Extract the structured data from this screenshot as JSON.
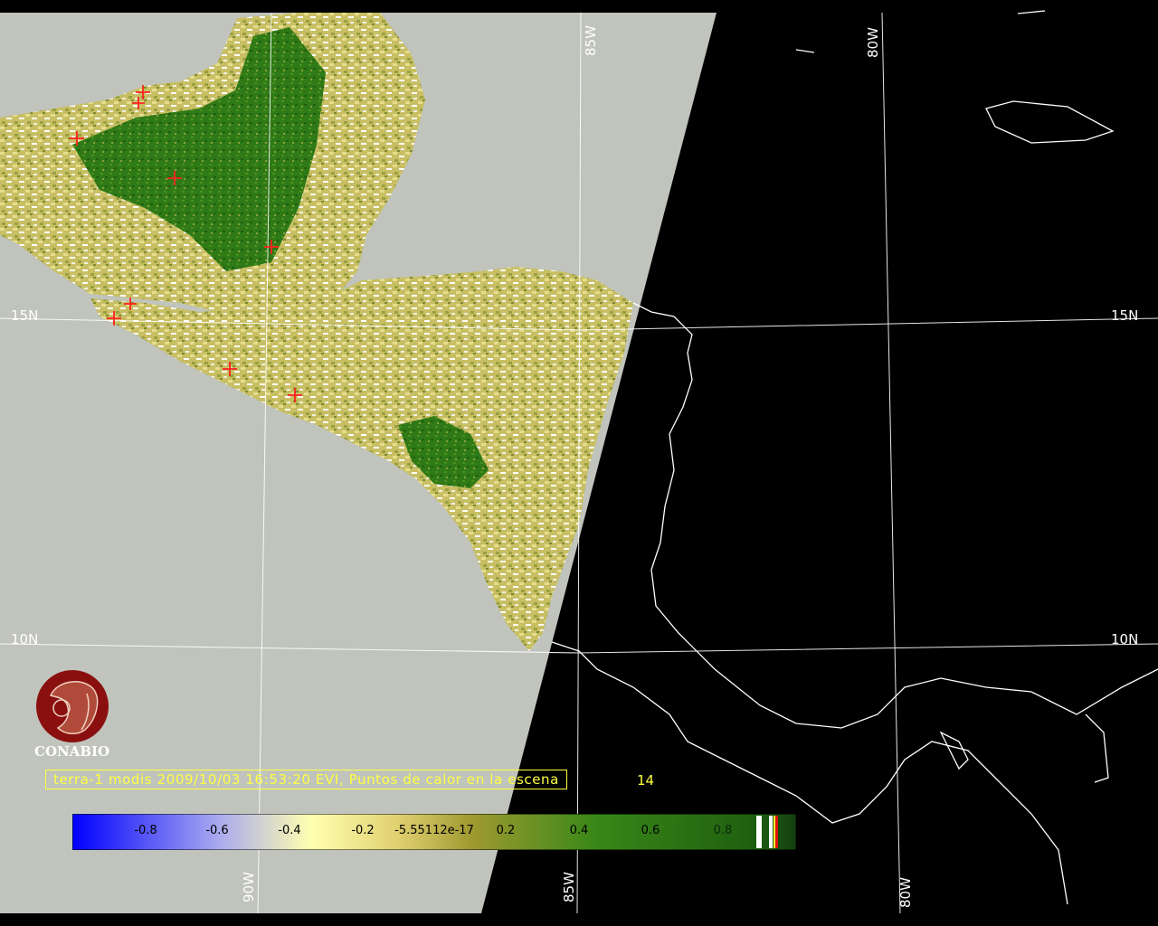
{
  "caption": {
    "text": "terra-1 modis 2009/10/03 16:53:20 EVI, Puntos de calor en la escena",
    "count": "14"
  },
  "logo": {
    "text": "CONABIO"
  },
  "grid_labels": {
    "lat_15": "15N",
    "lat_10": "10N",
    "lon_90": "90W",
    "lon_85": "85W",
    "lon_80": "80W"
  },
  "colorbar": {
    "ticks": [
      "-0.8",
      "-0.6",
      "-0.4",
      "-0.2",
      "-5.55112e-17",
      "0.2",
      "0.4",
      "0.6",
      "0.8"
    ],
    "colors": {
      "low": "#0000ff",
      "mid_low": "#ffffb0",
      "mid": "#9a9a30",
      "high": "#1f6b10"
    }
  },
  "colors": {
    "ocean_day": "#c0c4bc",
    "night": "#000000",
    "grid": "#ffffff",
    "hotspot": "#ff2020",
    "logo": "#8a1010",
    "caption": "#ffff40"
  }
}
